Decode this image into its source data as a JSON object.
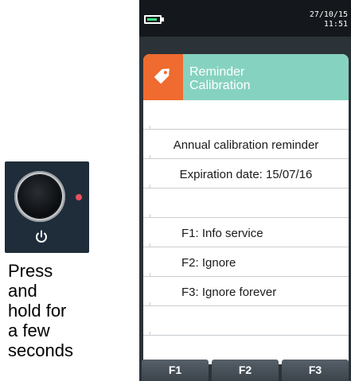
{
  "instruction": {
    "lines": [
      "Press",
      "and",
      "hold for",
      "a few",
      "seconds"
    ]
  },
  "status_bar": {
    "date": "27/10/15",
    "time": "11:51"
  },
  "header": {
    "title_line1": "Reminder",
    "title_line2": "Calibration"
  },
  "rows": [
    "",
    "Annual calibration reminder",
    "Expiration date: 15/07/16",
    "",
    "F1: Info service",
    "F2: Ignore",
    "F3: Ignore forever",
    "",
    ""
  ],
  "function_keys": [
    "F1",
    "F2",
    "F3"
  ],
  "colors": {
    "accent_orange": "#ef6b2f",
    "accent_teal": "#86d2c0",
    "led_red": "#e8505b",
    "battery_green": "#3ddc84"
  },
  "icons": {
    "power": "power-icon",
    "header": "tag-icon",
    "battery": "battery-icon"
  }
}
